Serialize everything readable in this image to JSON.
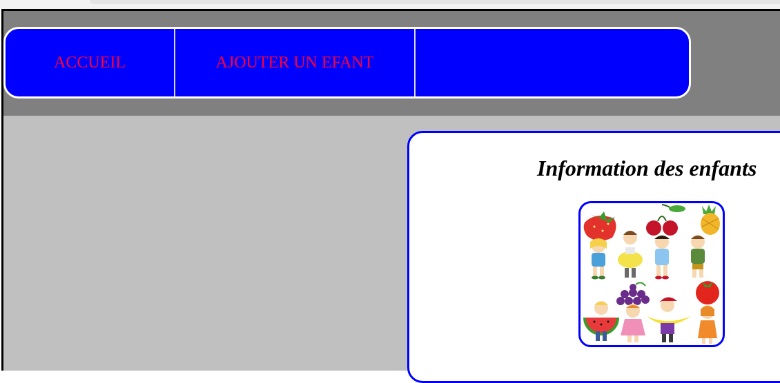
{
  "nav": {
    "items": [
      {
        "label": "ACCUEIL"
      },
      {
        "label": "AJOUTER UN EFANT"
      },
      {
        "label": ""
      }
    ]
  },
  "main": {
    "card_title": "Information des enfants",
    "image_alt": "enfants avec des fruits"
  },
  "colors": {
    "header_bg": "#808080",
    "nav_bg": "#0000ff",
    "nav_text": "#ff0033",
    "content_bg": "#c0c0c0",
    "card_border": "#0000ff"
  }
}
